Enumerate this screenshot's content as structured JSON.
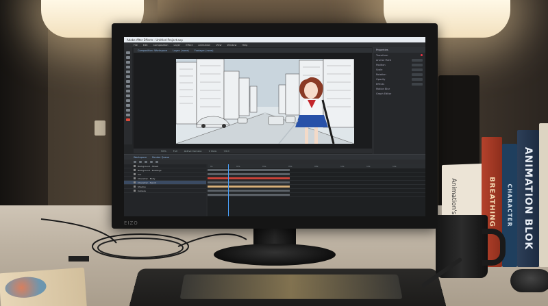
{
  "app": {
    "window_title": "Adobe After Effects - Untitled Project.aep",
    "menu": [
      "File",
      "Edit",
      "Composition",
      "Layer",
      "Effect",
      "Animation",
      "View",
      "Window",
      "Help"
    ],
    "workspace_tabs": [
      "Default",
      "Learn",
      "Standard",
      "Small Screen",
      "Libraries"
    ],
    "viewer_tabs": [
      "Composition: Workspace",
      "Layer: (none)",
      "Footage: (none)"
    ],
    "viewer_footer": [
      "50%",
      "Full",
      "Active Camera",
      "1 View",
      "+0.0"
    ],
    "timeline_tabs": [
      "Workspace",
      "Render Queue"
    ],
    "right_panel_title": "Properties",
    "right_panel_rows": [
      "Transform",
      "Anchor Point",
      "Position",
      "Scale",
      "Rotation",
      "Opacity",
      "Effects",
      "Motion Blur",
      "Graph Editor"
    ]
  },
  "layers": [
    "Background - Street",
    "Background - Buildings",
    "Car",
    "Character - Body",
    "Character - Sword",
    "Shadow",
    "Camera"
  ],
  "timeline_ruler": [
    "0s",
    "02s",
    "04s",
    "06s",
    "08s",
    "10s",
    "12s",
    "14s"
  ],
  "colors": {
    "track_red": "#c9443a",
    "track_tan": "#d7b07a",
    "track_gray": "#5c6268",
    "playhead": "#4aa3ff"
  },
  "books": {
    "cover": "Animation's Vocal",
    "spine_red": "BREATHING",
    "spine_navy": "CHARACTER",
    "spine_blue": "ANIMATION BLOK"
  },
  "monitor_logo": "EIZO"
}
